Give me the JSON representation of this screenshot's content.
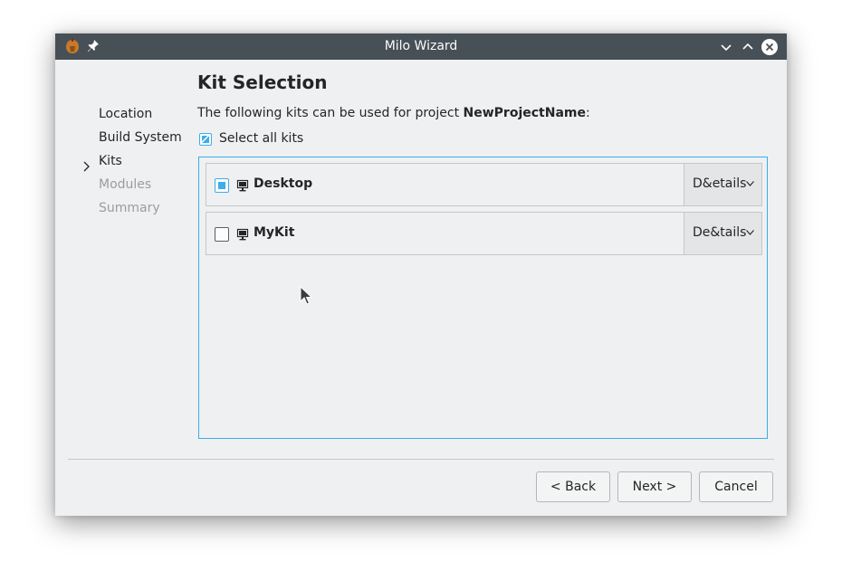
{
  "window": {
    "title": "Milo Wizard"
  },
  "steps": [
    {
      "label": "Location",
      "state": "done"
    },
    {
      "label": "Build System",
      "state": "done"
    },
    {
      "label": "Kits",
      "state": "current"
    },
    {
      "label": "Modules",
      "state": "future"
    },
    {
      "label": "Summary",
      "state": "future"
    }
  ],
  "page": {
    "title": "Kit Selection",
    "intro_prefix": "The following kits can be used for project ",
    "project_name": "NewProjectName",
    "intro_suffix": ":",
    "select_all_label": "Select all kits",
    "select_all_checked": true
  },
  "kits": [
    {
      "name": "Desktop",
      "checked": true,
      "details_label": "D&etails"
    },
    {
      "name": "MyKit",
      "checked": false,
      "details_label": "De&tails"
    }
  ],
  "buttons": {
    "back": "< Back",
    "next": "Next >",
    "cancel": "Cancel"
  },
  "colors": {
    "titlebar": "#475057",
    "accent": "#3daee9",
    "window_bg": "#eff0f1"
  }
}
